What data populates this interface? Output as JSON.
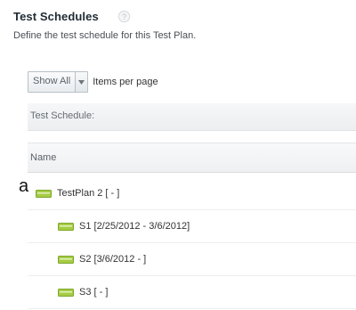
{
  "header": {
    "title": "Test Schedules",
    "subtitle": "Define the test schedule for this Test Plan."
  },
  "toolbar": {
    "page_size_value": "Show All",
    "items_label": "Items per page"
  },
  "section": {
    "label": "Test Schedule:"
  },
  "table": {
    "column_name": "Name"
  },
  "side_marker": "a",
  "tree": {
    "rows": [
      {
        "label": "TestPlan 2 [ - ]",
        "level": 0
      },
      {
        "label": "S1 [2/25/2012 - 3/6/2012]",
        "level": 1
      },
      {
        "label": "S2 [3/6/2012 - ]",
        "level": 1
      },
      {
        "label": "S3 [ - ]",
        "level": 1
      }
    ]
  },
  "icons": {
    "help": "help-icon",
    "select_arrow": "chevron-down-icon",
    "tree_item": "schedule-icon"
  },
  "colors": {
    "tree_icon": "#9ec63d",
    "accent": "#1f2a33"
  }
}
